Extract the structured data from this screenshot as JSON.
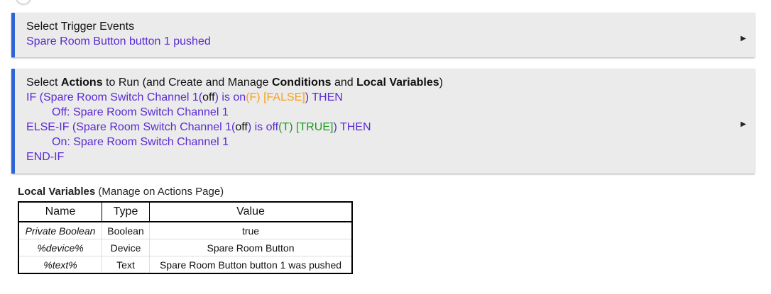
{
  "trigger": {
    "title": "Select Trigger Events",
    "text": "Spare Room Button button 1 pushed"
  },
  "actions": {
    "title_parts": [
      "Select ",
      "Actions",
      " to Run (and Create and Manage ",
      "Conditions",
      " and ",
      "Local Variables",
      ")"
    ],
    "if_line": [
      "IF (Spare Room Switch Channel 1(",
      "off",
      ") is on",
      "(F) [FALSE]",
      ") THEN"
    ],
    "if_action": "Off: Spare Room Switch Channel 1",
    "elseif_line": [
      "ELSE-IF (Spare Room Switch Channel 1(",
      "off",
      ") is off",
      "(T) [TRUE]",
      ") THEN"
    ],
    "elseif_action": "On: Spare Room Switch Channel 1",
    "endif": "END-IF"
  },
  "local_vars": {
    "title": "Local Variables",
    "subtitle": " (Manage on Actions Page)",
    "headers": [
      "Name",
      "Type",
      "Value"
    ],
    "rows": [
      [
        "Private Boolean",
        "Boolean",
        "true"
      ],
      [
        "%device%",
        "Device",
        "Spare Room Button"
      ],
      [
        "%text%",
        "Text",
        "Spare Room Button button 1 was pushed"
      ]
    ]
  },
  "colors": {
    "accent": "#2f64d6",
    "text": "#5a2ad2",
    "false": "#f7a21b",
    "true": "#1d9a1d"
  },
  "icons": {
    "expand": "triangle-right-icon"
  }
}
